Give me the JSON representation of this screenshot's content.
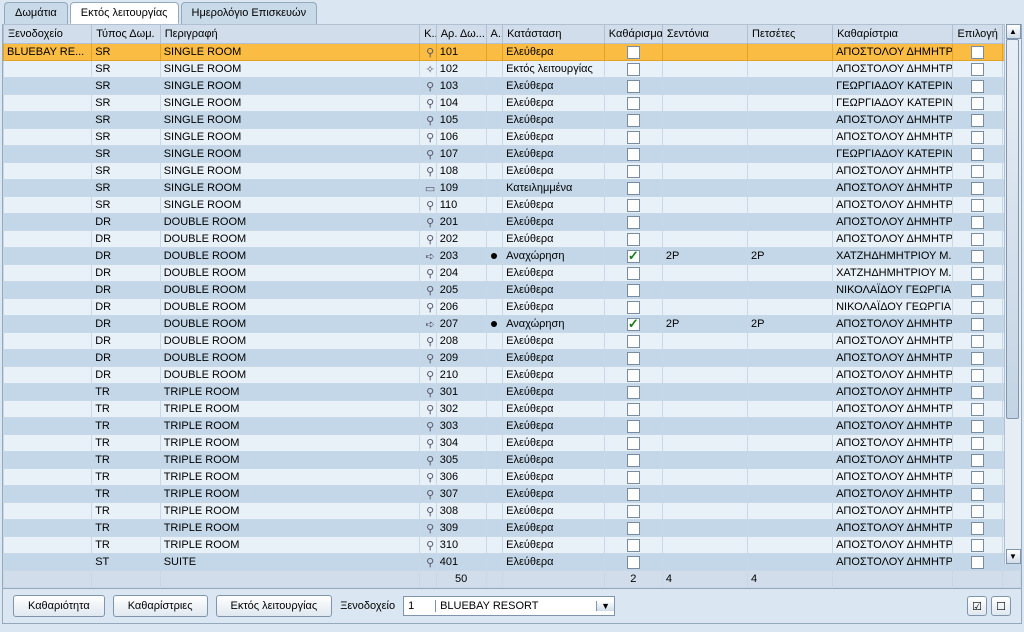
{
  "tabs": {
    "rooms": "Δωμάτια",
    "out": "Εκτός λειτουργίας",
    "log": "Ημερολόγιο Επισκευών",
    "active": 1
  },
  "columns": {
    "hotel": "Ξενοδοχείο",
    "type": "Τύπος Δωμ.",
    "desc": "Περιγραφή",
    "k": "Κ..",
    "room": "Αρ. Δω...",
    "a": "Α..",
    "status": "Κατάσταση",
    "clean": "Καθάρισμα",
    "sheet": "Σεντόνια",
    "towel": "Πετσέτες",
    "maid": "Καθαρίστρια",
    "sel": "Επιλογή"
  },
  "icons": {
    "key": "⚲",
    "wrench": "🔧",
    "bed": "▭",
    "depart": "➪"
  },
  "rows": [
    {
      "hotel": "BLUEBAY RE...",
      "type": "SR",
      "desc": "SINGLE ROOM",
      "ico": "key",
      "room": "101",
      "a": "",
      "status": "Ελεύθερα",
      "clean": false,
      "sheet": "",
      "towel": "",
      "maid": "ΑΠΟΣΤΟΛΟΥ ΔΗΜΗΤΡΑ",
      "sel": true,
      "alt": false
    },
    {
      "hotel": "",
      "type": "SR",
      "desc": "SINGLE ROOM",
      "ico": "wrench",
      "room": "102",
      "a": "",
      "status": "Εκτός λειτουργίας",
      "clean": false,
      "sheet": "",
      "towel": "",
      "maid": "ΑΠΟΣΤΟΛΟΥ ΔΗΜΗΤΡΑ",
      "alt": false
    },
    {
      "hotel": "",
      "type": "SR",
      "desc": "SINGLE ROOM",
      "ico": "key",
      "room": "103",
      "a": "",
      "status": "Ελεύθερα",
      "clean": false,
      "sheet": "",
      "towel": "",
      "maid": "ΓΕΩΡΓΙΑΔΟΥ ΚΑΤΕΡΙΝΑ",
      "alt": true
    },
    {
      "hotel": "",
      "type": "SR",
      "desc": "SINGLE ROOM",
      "ico": "key",
      "room": "104",
      "a": "",
      "status": "Ελεύθερα",
      "clean": false,
      "sheet": "",
      "towel": "",
      "maid": "ΓΕΩΡΓΙΑΔΟΥ ΚΑΤΕΡΙΝΑ",
      "alt": false
    },
    {
      "hotel": "",
      "type": "SR",
      "desc": "SINGLE ROOM",
      "ico": "key",
      "room": "105",
      "a": "",
      "status": "Ελεύθερα",
      "clean": false,
      "sheet": "",
      "towel": "",
      "maid": "ΑΠΟΣΤΟΛΟΥ ΔΗΜΗΤΡΑ",
      "alt": true
    },
    {
      "hotel": "",
      "type": "SR",
      "desc": "SINGLE ROOM",
      "ico": "key",
      "room": "106",
      "a": "",
      "status": "Ελεύθερα",
      "clean": false,
      "sheet": "",
      "towel": "",
      "maid": "ΑΠΟΣΤΟΛΟΥ ΔΗΜΗΤΡΑ",
      "alt": false
    },
    {
      "hotel": "",
      "type": "SR",
      "desc": "SINGLE ROOM",
      "ico": "key",
      "room": "107",
      "a": "",
      "status": "Ελεύθερα",
      "clean": false,
      "sheet": "",
      "towel": "",
      "maid": "ΓΕΩΡΓΙΑΔΟΥ ΚΑΤΕΡΙΝΑ",
      "alt": true
    },
    {
      "hotel": "",
      "type": "SR",
      "desc": "SINGLE ROOM",
      "ico": "key",
      "room": "108",
      "a": "",
      "status": "Ελεύθερα",
      "clean": false,
      "sheet": "",
      "towel": "",
      "maid": "ΑΠΟΣΤΟΛΟΥ ΔΗΜΗΤΡΑ",
      "alt": false
    },
    {
      "hotel": "",
      "type": "SR",
      "desc": "SINGLE ROOM",
      "ico": "bed",
      "room": "109",
      "a": "",
      "status": "Κατειλημμένα",
      "clean": false,
      "sheet": "",
      "towel": "",
      "maid": "ΑΠΟΣΤΟΛΟΥ ΔΗΜΗΤΡΑ",
      "alt": true
    },
    {
      "hotel": "",
      "type": "SR",
      "desc": "SINGLE ROOM",
      "ico": "key",
      "room": "110",
      "a": "",
      "status": "Ελεύθερα",
      "clean": false,
      "sheet": "",
      "towel": "",
      "maid": "ΑΠΟΣΤΟΛΟΥ ΔΗΜΗΤΡΑ",
      "alt": false
    },
    {
      "hotel": "",
      "type": "DR",
      "desc": "DOUBLE ROOM",
      "ico": "key",
      "room": "201",
      "a": "",
      "status": "Ελεύθερα",
      "clean": false,
      "sheet": "",
      "towel": "",
      "maid": "ΑΠΟΣΤΟΛΟΥ ΔΗΜΗΤΡΑ",
      "alt": true
    },
    {
      "hotel": "",
      "type": "DR",
      "desc": "DOUBLE ROOM",
      "ico": "key",
      "room": "202",
      "a": "",
      "status": "Ελεύθερα",
      "clean": false,
      "sheet": "",
      "towel": "",
      "maid": "ΑΠΟΣΤΟΛΟΥ ΔΗΜΗΤΡΑ",
      "alt": false
    },
    {
      "hotel": "",
      "type": "DR",
      "desc": "DOUBLE ROOM",
      "ico": "depart",
      "room": "203",
      "a": "dot",
      "status": "Αναχώρηση",
      "clean": true,
      "sheet": "2P",
      "towel": "2P",
      "maid": "ΧΑΤΖΗΔΗΜΗΤΡΙΟΥ Μ...",
      "alt": true
    },
    {
      "hotel": "",
      "type": "DR",
      "desc": "DOUBLE ROOM",
      "ico": "key",
      "room": "204",
      "a": "",
      "status": "Ελεύθερα",
      "clean": false,
      "sheet": "",
      "towel": "",
      "maid": "ΧΑΤΖΗΔΗΜΗΤΡΙΟΥ Μ...",
      "alt": false
    },
    {
      "hotel": "",
      "type": "DR",
      "desc": "DOUBLE ROOM",
      "ico": "key",
      "room": "205",
      "a": "",
      "status": "Ελεύθερα",
      "clean": false,
      "sheet": "",
      "towel": "",
      "maid": "ΝΙΚΟΛΑΪΔΟΥ ΓΕΩΡΓΙΑ",
      "alt": true
    },
    {
      "hotel": "",
      "type": "DR",
      "desc": "DOUBLE ROOM",
      "ico": "key",
      "room": "206",
      "a": "",
      "status": "Ελεύθερα",
      "clean": false,
      "sheet": "",
      "towel": "",
      "maid": "ΝΙΚΟΛΑΪΔΟΥ ΓΕΩΡΓΙΑ",
      "alt": false
    },
    {
      "hotel": "",
      "type": "DR",
      "desc": "DOUBLE ROOM",
      "ico": "depart",
      "room": "207",
      "a": "dot",
      "status": "Αναχώρηση",
      "clean": true,
      "sheet": "2P",
      "towel": "2P",
      "maid": "ΑΠΟΣΤΟΛΟΥ ΔΗΜΗΤΡΑ",
      "alt": true
    },
    {
      "hotel": "",
      "type": "DR",
      "desc": "DOUBLE ROOM",
      "ico": "key",
      "room": "208",
      "a": "",
      "status": "Ελεύθερα",
      "clean": false,
      "sheet": "",
      "towel": "",
      "maid": "ΑΠΟΣΤΟΛΟΥ ΔΗΜΗΤΡΑ",
      "alt": false
    },
    {
      "hotel": "",
      "type": "DR",
      "desc": "DOUBLE ROOM",
      "ico": "key",
      "room": "209",
      "a": "",
      "status": "Ελεύθερα",
      "clean": false,
      "sheet": "",
      "towel": "",
      "maid": "ΑΠΟΣΤΟΛΟΥ ΔΗΜΗΤΡΑ",
      "alt": true
    },
    {
      "hotel": "",
      "type": "DR",
      "desc": "DOUBLE ROOM",
      "ico": "key",
      "room": "210",
      "a": "",
      "status": "Ελεύθερα",
      "clean": false,
      "sheet": "",
      "towel": "",
      "maid": "ΑΠΟΣΤΟΛΟΥ ΔΗΜΗΤΡΑ",
      "alt": false
    },
    {
      "hotel": "",
      "type": "TR",
      "desc": "TRIPLE ROOM",
      "ico": "key",
      "room": "301",
      "a": "",
      "status": "Ελεύθερα",
      "clean": false,
      "sheet": "",
      "towel": "",
      "maid": "ΑΠΟΣΤΟΛΟΥ ΔΗΜΗΤΡΑ",
      "alt": true
    },
    {
      "hotel": "",
      "type": "TR",
      "desc": "TRIPLE ROOM",
      "ico": "key",
      "room": "302",
      "a": "",
      "status": "Ελεύθερα",
      "clean": false,
      "sheet": "",
      "towel": "",
      "maid": "ΑΠΟΣΤΟΛΟΥ ΔΗΜΗΤΡΑ",
      "alt": false
    },
    {
      "hotel": "",
      "type": "TR",
      "desc": "TRIPLE ROOM",
      "ico": "key",
      "room": "303",
      "a": "",
      "status": "Ελεύθερα",
      "clean": false,
      "sheet": "",
      "towel": "",
      "maid": "ΑΠΟΣΤΟΛΟΥ ΔΗΜΗΤΡΑ",
      "alt": true
    },
    {
      "hotel": "",
      "type": "TR",
      "desc": "TRIPLE ROOM",
      "ico": "key",
      "room": "304",
      "a": "",
      "status": "Ελεύθερα",
      "clean": false,
      "sheet": "",
      "towel": "",
      "maid": "ΑΠΟΣΤΟΛΟΥ ΔΗΜΗΤΡΑ",
      "alt": false
    },
    {
      "hotel": "",
      "type": "TR",
      "desc": "TRIPLE ROOM",
      "ico": "key",
      "room": "305",
      "a": "",
      "status": "Ελεύθερα",
      "clean": false,
      "sheet": "",
      "towel": "",
      "maid": "ΑΠΟΣΤΟΛΟΥ ΔΗΜΗΤΡΑ",
      "alt": true
    },
    {
      "hotel": "",
      "type": "TR",
      "desc": "TRIPLE ROOM",
      "ico": "key",
      "room": "306",
      "a": "",
      "status": "Ελεύθερα",
      "clean": false,
      "sheet": "",
      "towel": "",
      "maid": "ΑΠΟΣΤΟΛΟΥ ΔΗΜΗΤΡΑ",
      "alt": false
    },
    {
      "hotel": "",
      "type": "TR",
      "desc": "TRIPLE ROOM",
      "ico": "key",
      "room": "307",
      "a": "",
      "status": "Ελεύθερα",
      "clean": false,
      "sheet": "",
      "towel": "",
      "maid": "ΑΠΟΣΤΟΛΟΥ ΔΗΜΗΤΡΑ",
      "alt": true
    },
    {
      "hotel": "",
      "type": "TR",
      "desc": "TRIPLE ROOM",
      "ico": "key",
      "room": "308",
      "a": "",
      "status": "Ελεύθερα",
      "clean": false,
      "sheet": "",
      "towel": "",
      "maid": "ΑΠΟΣΤΟΛΟΥ ΔΗΜΗΤΡΑ",
      "alt": false
    },
    {
      "hotel": "",
      "type": "TR",
      "desc": "TRIPLE ROOM",
      "ico": "key",
      "room": "309",
      "a": "",
      "status": "Ελεύθερα",
      "clean": false,
      "sheet": "",
      "towel": "",
      "maid": "ΑΠΟΣΤΟΛΟΥ ΔΗΜΗΤΡΑ",
      "alt": true
    },
    {
      "hotel": "",
      "type": "TR",
      "desc": "TRIPLE ROOM",
      "ico": "key",
      "room": "310",
      "a": "",
      "status": "Ελεύθερα",
      "clean": false,
      "sheet": "",
      "towel": "",
      "maid": "ΑΠΟΣΤΟΛΟΥ ΔΗΜΗΤΡΑ",
      "alt": false
    },
    {
      "hotel": "",
      "type": "ST",
      "desc": "SUITE",
      "ico": "key",
      "room": "401",
      "a": "",
      "status": "Ελεύθερα",
      "clean": false,
      "sheet": "",
      "towel": "",
      "maid": "ΑΠΟΣΤΟΛΟΥ ΔΗΜΗΤΡΑ",
      "alt": true
    }
  ],
  "summary": {
    "count": "50",
    "clean": "2",
    "sheet": "4",
    "towel": "4"
  },
  "bottom": {
    "btn_clean": "Καθαριότητα",
    "btn_maids": "Καθαρίστριες",
    "btn_out": "Εκτός λειτουργίας",
    "hotel_label": "Ξενοδοχείο",
    "hotel_code": "1",
    "hotel_name": "BLUEBAY RESORT"
  }
}
